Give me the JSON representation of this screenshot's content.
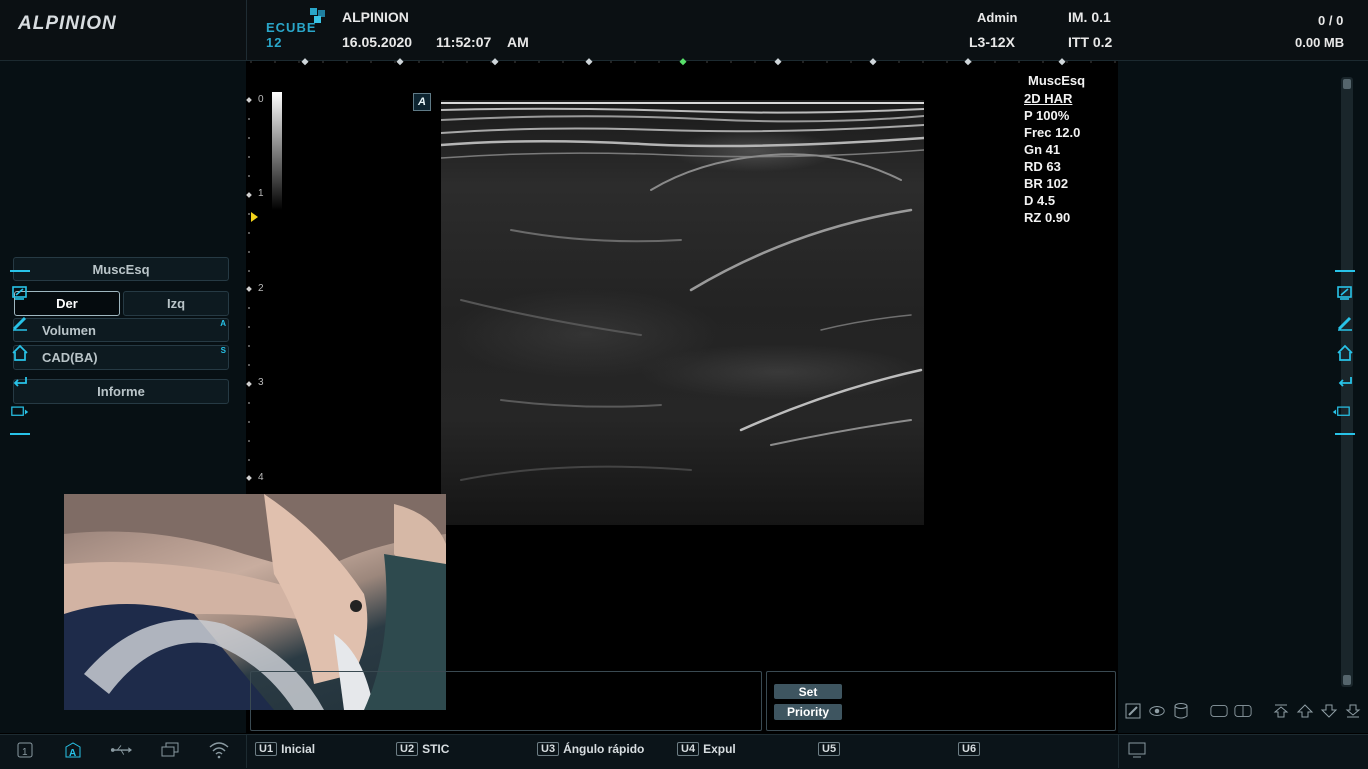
{
  "header": {
    "brand": "ALPINION",
    "product_logo": "ECUBE 12",
    "hospital": "ALPINION",
    "date": "16.05.2020",
    "time": "11:52:07",
    "ampm": "AM",
    "user": "Admin",
    "probe": "L3-12X",
    "im": "IM. 0.1",
    "itt": "ITT 0.2",
    "counter": "0 / 0",
    "storage": "0.00 MB"
  },
  "left_panel": {
    "preset": "MuscEsq",
    "side_right": "Der",
    "side_left": "Izq",
    "volume": "Volumen",
    "volume_badge": "A",
    "cad": "CAD(BA)",
    "cad_badge": "S",
    "report": "Informe"
  },
  "scan": {
    "preset": "MuscEsq",
    "mode": "2D HAR",
    "params": [
      "P 100%",
      "Frec 12.0",
      "Gn 41",
      "RD 63",
      "BR 102",
      "D 4.5",
      "RZ 0.90"
    ],
    "depth_labels": [
      "0",
      "1",
      "2",
      "3",
      "4"
    ],
    "orientation_marker": "A"
  },
  "bottom_panel": {
    "set_label": "Set",
    "priority_label": "Priority"
  },
  "userkeys": [
    {
      "tag": "U1",
      "label": "Inicial"
    },
    {
      "tag": "U2",
      "label": "STIC"
    },
    {
      "tag": "U3",
      "label": "Ángulo rápido"
    },
    {
      "tag": "U4",
      "label": "Expul"
    },
    {
      "tag": "U5",
      "label": ""
    },
    {
      "tag": "U6",
      "label": ""
    }
  ],
  "colors": {
    "accent": "#28c3e8",
    "background": "#000000",
    "panel": "#071014"
  }
}
